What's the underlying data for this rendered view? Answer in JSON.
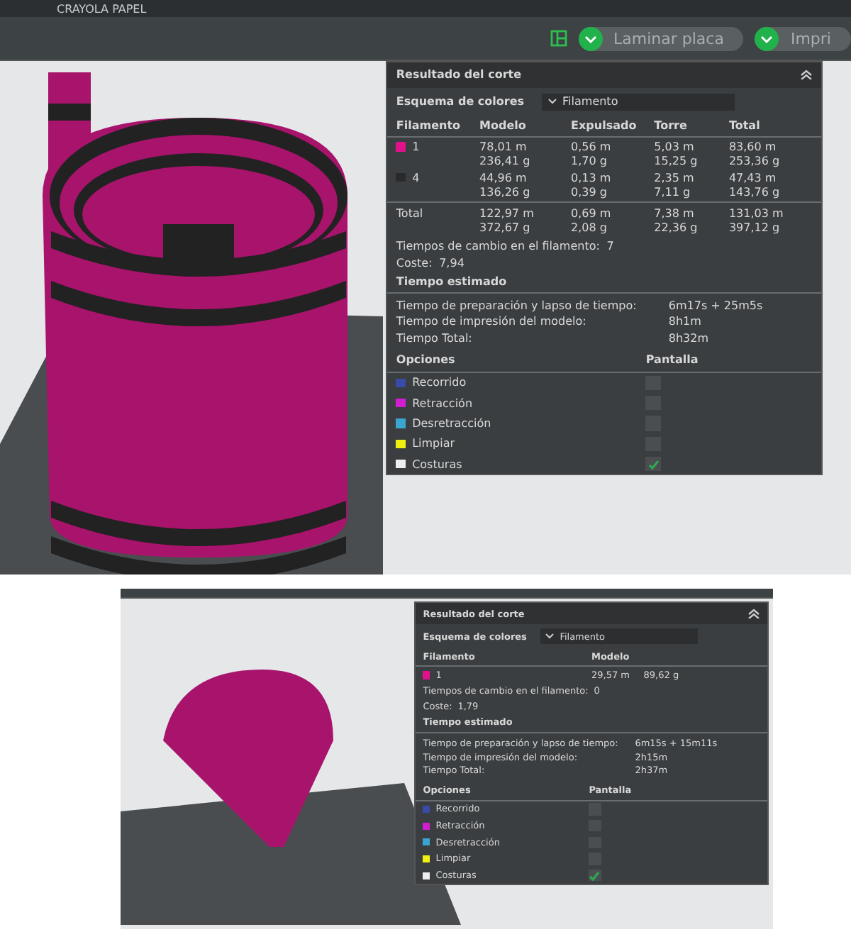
{
  "screens": [
    {
      "kind": "full",
      "title": "CRAYOLA PAPEL",
      "toolbar_buttons": [
        {
          "label": "Laminar placa"
        },
        {
          "label": "Impri"
        }
      ],
      "panel": {
        "title": "Resultado del corte",
        "scheme_label": "Esquema de colores",
        "scheme_value": "Filamento",
        "columns": [
          "Filamento",
          "Modelo",
          "Expulsado",
          "Torre",
          "Total"
        ],
        "rows": [
          {
            "color": "#e0118a",
            "cells": [
              [
                "1"
              ],
              [
                "78,01 m",
                "236,41 g"
              ],
              [
                "0,56 m",
                "1,70 g"
              ],
              [
                "5,03 m",
                "15,25 g"
              ],
              [
                "83,60 m",
                "253,36 g"
              ]
            ]
          },
          {
            "color": "#2a2a2a",
            "cells": [
              [
                "4"
              ],
              [
                "44,96 m",
                "136,26 g"
              ],
              [
                "0,13 m",
                "0,39 g"
              ],
              [
                "2,35 m",
                "7,11 g"
              ],
              [
                "47,43 m",
                "143,76 g"
              ]
            ]
          }
        ],
        "total": {
          "cells": [
            [
              "Total"
            ],
            [
              "122,97 m",
              "372,67 g"
            ],
            [
              "0,69 m",
              "2,08 g"
            ],
            [
              "7,38 m",
              "22,36 g"
            ],
            [
              "131,03 m",
              "397,12 g"
            ]
          ]
        },
        "change_label": "Tiempos de cambio en el filamento:",
        "change_value": "7",
        "cost_label": "Coste:",
        "cost_value": "7,94",
        "time_title": "Tiempo estimado",
        "times": [
          {
            "label": "Tiempo de preparación y lapso de tiempo:",
            "value": "6m17s + 25m5s"
          },
          {
            "label": "Tiempo de impresión del modelo:",
            "value": "8h1m"
          },
          {
            "label": "Tiempo Total:",
            "value": "8h32m"
          }
        ],
        "options_header": [
          "Opciones",
          "Pantalla"
        ],
        "options": [
          {
            "label": "Recorrido",
            "color": "#3a4aa8",
            "checked": false
          },
          {
            "label": "Retracción",
            "color": "#d21ed2",
            "checked": false
          },
          {
            "label": "Desretracción",
            "color": "#3aa6d0",
            "checked": false
          },
          {
            "label": "Limpiar",
            "color": "#f0f010",
            "checked": false
          },
          {
            "label": "Costuras",
            "color": "#eeeeee",
            "checked": true
          }
        ]
      }
    },
    {
      "kind": "compact",
      "panel": {
        "title": "Resultado del corte",
        "scheme_label": "Esquema de colores",
        "scheme_value": "Filamento",
        "columns": [
          "Filamento",
          "Modelo"
        ],
        "rows": [
          {
            "color": "#e0118a",
            "cells": [
              [
                "1"
              ],
              [
                "29,57 m",
                "89,62 g"
              ]
            ]
          }
        ],
        "change_label": "Tiempos de cambio en el filamento:",
        "change_value": "0",
        "cost_label": "Coste:",
        "cost_value": "1,79",
        "time_title": "Tiempo estimado",
        "times": [
          {
            "label": "Tiempo de preparación y lapso de tiempo:",
            "value": "6m15s + 15m11s"
          },
          {
            "label": "Tiempo de impresión del modelo:",
            "value": "2h15m"
          },
          {
            "label": "Tiempo Total:",
            "value": "2h37m"
          }
        ],
        "options_header": [
          "Opciones",
          "Pantalla"
        ],
        "options": [
          {
            "label": "Recorrido",
            "color": "#3a4aa8",
            "checked": false
          },
          {
            "label": "Retracción",
            "color": "#d21ed2",
            "checked": false
          },
          {
            "label": "Desretracción",
            "color": "#3aa6d0",
            "checked": false
          },
          {
            "label": "Limpiar",
            "color": "#f0f010",
            "checked": false
          },
          {
            "label": "Costuras",
            "color": "#eeeeee",
            "checked": true
          }
        ]
      }
    }
  ]
}
